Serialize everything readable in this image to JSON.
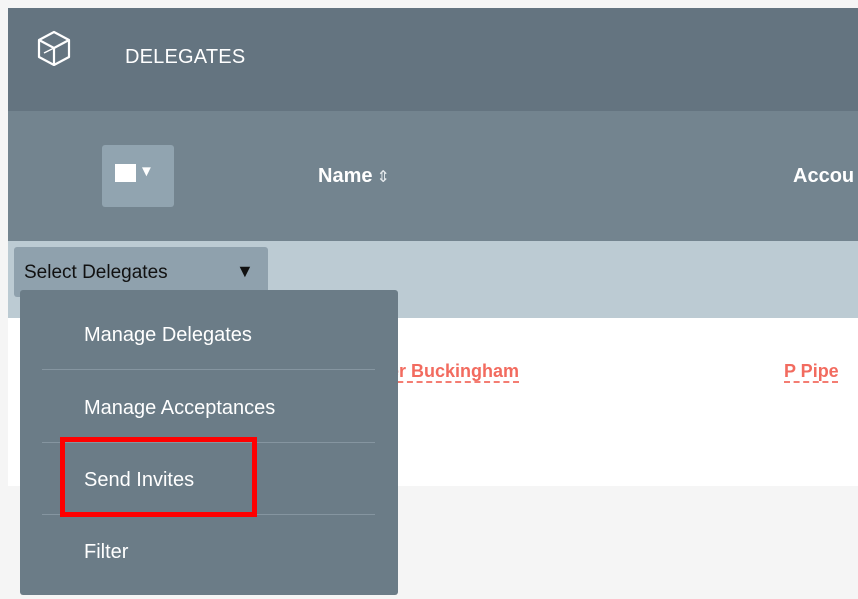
{
  "panel": {
    "title": "DELEGATES",
    "icon": "cube-icon"
  },
  "columns": {
    "name": "Name",
    "sort_icon": "⇕",
    "account": "Accou"
  },
  "rows": [
    {
      "name": "der Buckingham",
      "account": "P Pipe"
    }
  ],
  "select_menu": {
    "trigger_label": "Select Delegates",
    "trigger_arrow": "▼",
    "items": [
      "Manage Delegates",
      "Manage Acceptances",
      "Send Invites",
      "Filter"
    ]
  },
  "colors": {
    "header": "#647480",
    "column_header": "#73848f",
    "select_bar": "#bccbd3",
    "link": "#f26b5f",
    "dropdown": "#6b7c87",
    "highlight": "#ff0000"
  }
}
